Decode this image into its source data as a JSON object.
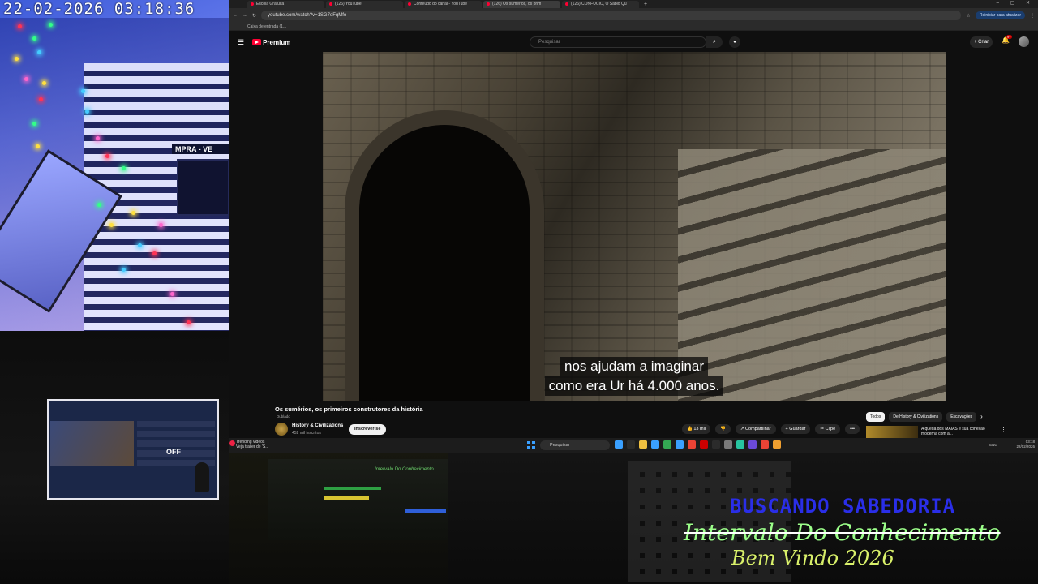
{
  "webcam": {
    "timestamp": "22-02-2026  03:18:36",
    "sign_text": "MPRA - VE"
  },
  "browser": {
    "tabs": [
      {
        "label": "Escola Gratuita",
        "active": false
      },
      {
        "label": "(126) YouTube",
        "active": false
      },
      {
        "label": "Conteúdo do canal - YouTube",
        "active": false
      },
      {
        "label": "(126) Os sumérios, os prim",
        "active": true
      },
      {
        "label": "(126) CONFUCIO, O Sábio Qu",
        "active": false
      }
    ],
    "url": "youtube.com/watch?v=1SG7oFqMfo",
    "update_button": "Reiniciar para atualizar",
    "bookmark": "Caixa de entrada (1..."
  },
  "youtube": {
    "logo_text": "Premium",
    "search_placeholder": "Pesquisar",
    "create_label": "+ Criar",
    "notification_count": "9+",
    "subtitles": [
      "nos ajudam a imaginar",
      "como era Ur há 4.000 anos."
    ],
    "video_title": "Os sumérios, os primeiros construtores da história",
    "dubbed_label": "Dublado",
    "channel_name": "History & Civilizations",
    "channel_subs": "452 mil inscritos",
    "subscribe_label": "Inscrever-se",
    "actions": [
      "👍 13 mil",
      "👎",
      "↗ Compartilhar",
      "+ Guardar",
      "✂ Clipe",
      "•••"
    ],
    "chips": [
      "Todos",
      "De History & Civilizations",
      "Escavações"
    ],
    "rec_title": "A queda dos MAIAS e sua conexão moderna com a..."
  },
  "taskbar": {
    "weather_title": "Trending videos",
    "weather_sub": "Veja trailer de 'S...",
    "search_placeholder": "Pesquisar",
    "lang": "ENG",
    "time": "03:18",
    "date": "22/02/2026",
    "icon_colors": [
      "#3aa0ff",
      "#2b2b2b",
      "#f0c040",
      "#3aa0ff",
      "#34a853",
      "#3aa0ff",
      "#ea4335",
      "#cc0000",
      "#2b2b2b",
      "#7a7a7a",
      "#27c4a0",
      "#6a4ad8",
      "#ea4335",
      "#f0a030"
    ]
  },
  "mini_monitor": {
    "offer_text": "OFF"
  },
  "mini_screen_caption": "Intervalo Do Conhecimento",
  "branding": {
    "line1": "BUSCANDO SABEDORIA",
    "line2": "Intervalo Do Conhecimento",
    "line3": "Bem Vindo 2026"
  }
}
